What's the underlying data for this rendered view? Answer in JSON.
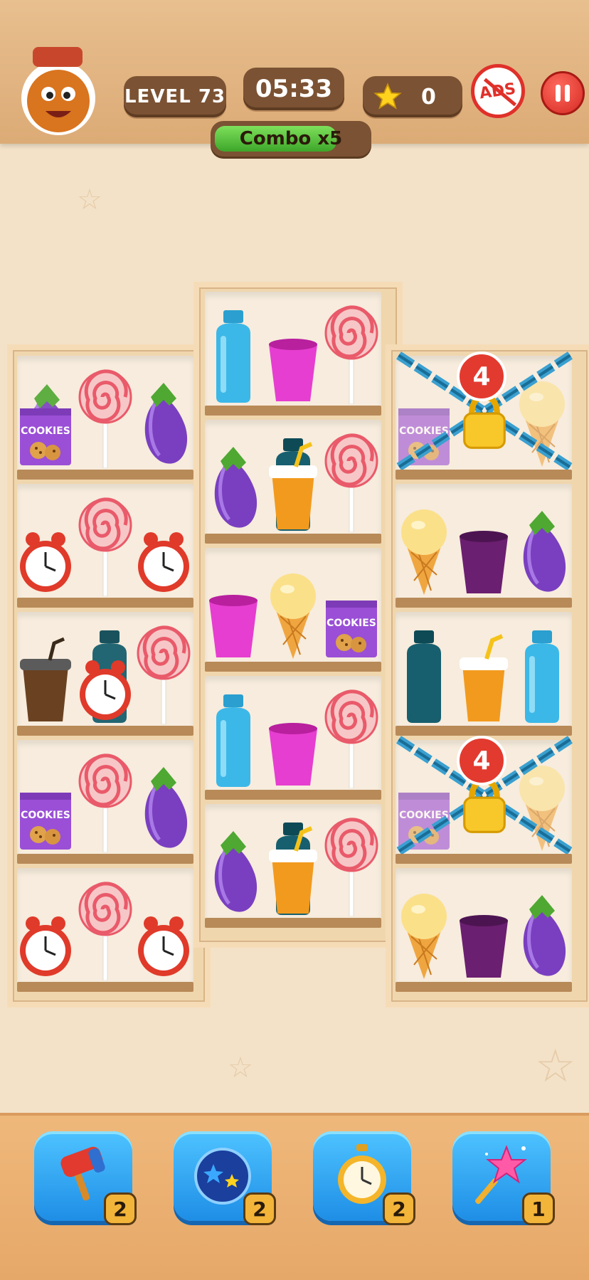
{
  "hud": {
    "level_label": "LEVEL 73",
    "timer": "05:33",
    "star_count": "0",
    "ads_label": "ADS",
    "combo_label": "Combo x5",
    "combo_fill_fraction": 0.8
  },
  "locks": {
    "top_count": "4",
    "bottom_count": "4"
  },
  "items": {
    "cookies_label": "COOKIES"
  },
  "boosters": [
    {
      "name": "hammer",
      "count": "2"
    },
    {
      "name": "shuffle",
      "count": "2"
    },
    {
      "name": "clock",
      "count": "2"
    },
    {
      "name": "magic-wand",
      "count": "1"
    }
  ],
  "colors": {
    "topbar": "#dcab76",
    "pill": "#7b5233",
    "combo_fill": "#4fbf35",
    "lock_badge": "#e33a2f",
    "booster": "#2a9cf0"
  }
}
